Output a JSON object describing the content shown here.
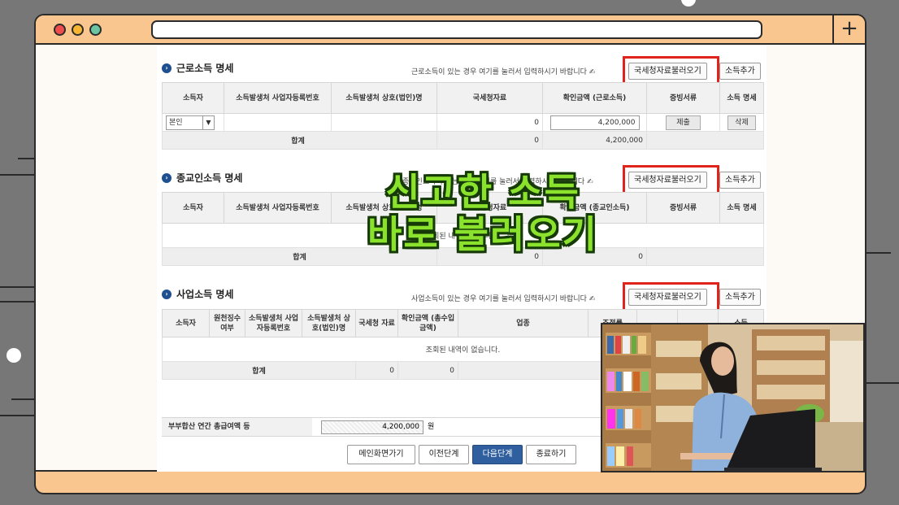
{
  "overlay": {
    "line1": "신고한 소득",
    "line2": "바로 불러오기"
  },
  "browser": {
    "new_tab_symbol": "+"
  },
  "earned": {
    "title": "근로소득 명세",
    "hint": "근로소득이 있는 경우 여기를 눌러서 입력하시기 바랍니다 ✍",
    "fetch_btn": "국세청자료불러오기",
    "add_btn": "소득추가",
    "headers": [
      "소득자",
      "소득발생처 사업자등록번호",
      "소득발생처 상호(법인)명",
      "국세청자료",
      "확인금액 (근로소득)",
      "증빙서류",
      "소득 명세"
    ],
    "row": {
      "earner": "본인",
      "nts": "0",
      "amount": "4,200,000",
      "submit": "제출",
      "delete": "삭제"
    },
    "sum": {
      "label": "합계",
      "nts": "0",
      "amount": "4,200,000"
    }
  },
  "religious": {
    "title": "종교인소득 명세",
    "hint": "종교인소득이 있는 경우 여기를 눌러서 입력하시기 바랍니다 ✍",
    "fetch_btn": "국세청자료불러오기",
    "add_btn": "소득추가",
    "headers": [
      "소득자",
      "소득발생처 사업자등록번호",
      "소득발생처 상호(법인)명",
      "국세청자료",
      "확인금액 (종교인소득)",
      "증빙서류",
      "소득 명세"
    ],
    "empty": "조회된 내역이 없습니다.",
    "sum": {
      "label": "합계",
      "nts": "0",
      "amount": "0"
    }
  },
  "business": {
    "title": "사업소득 명세",
    "hint": "사업소득이 있는 경우 여기를 눌러서 입력하시기 바랍니다 ✍",
    "fetch_btn": "국세청자료불러오기",
    "add_btn": "소득추가",
    "headers": [
      "소득자",
      "원천징수 여부",
      "소득발생처 사업자등록번호",
      "소득발생처 상호(법인)명",
      "국세청 자료",
      "확인금액 (총수입금액)",
      "업종",
      "조정률",
      "",
      "",
      "소득"
    ],
    "empty": "조회된 내역이 없습니다.",
    "sum": {
      "label": "합계",
      "nts": "0",
      "amount": "0"
    }
  },
  "total": {
    "label": "부부합산 연간 총급여액 등",
    "value": "4,200,000",
    "unit": "원"
  },
  "nav": {
    "main": "메인화면가기",
    "prev": "이전단계",
    "next": "다음단계",
    "end": "종료하기"
  },
  "colors": {
    "overlay_green": "#8be22c",
    "highlight_red": "#e0231b",
    "primary_blue": "#2f5f9e",
    "frame_orange": "#f9c690"
  }
}
